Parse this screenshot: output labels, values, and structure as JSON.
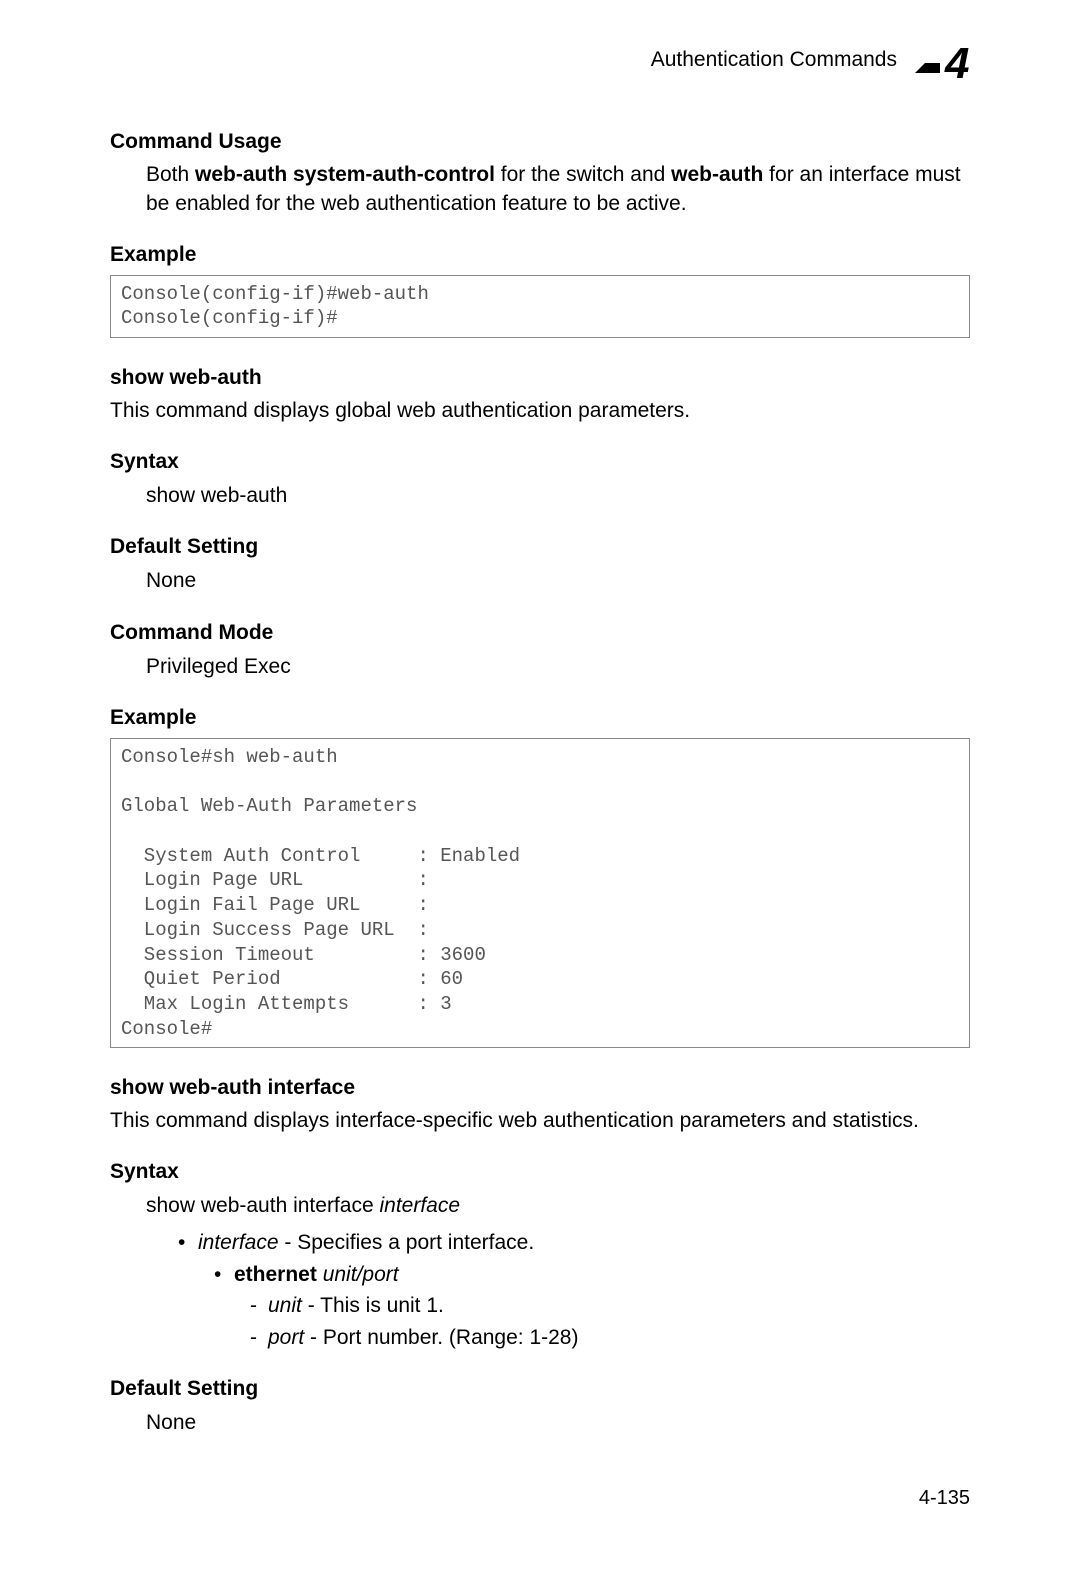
{
  "header": {
    "title": "Authentication Commands",
    "chapter_number": "4"
  },
  "sections": {
    "command_usage": {
      "heading": "Command Usage",
      "text_pre": "Both ",
      "bold1": "web-auth system-auth-control",
      "text_mid": " for the switch and ",
      "bold2": "web-auth",
      "text_post": " for an interface must be enabled for the web authentication feature to be active."
    },
    "example1": {
      "heading": "Example",
      "code": "Console(config-if)#web-auth\nConsole(config-if)#"
    },
    "show_web_auth": {
      "heading": "show web-auth",
      "description": "This command displays global web authentication parameters.",
      "syntax_heading": "Syntax",
      "syntax_text": "show web-auth",
      "default_heading": "Default Setting",
      "default_text": "None",
      "mode_heading": "Command Mode",
      "mode_text": "Privileged Exec"
    },
    "example2": {
      "heading": "Example",
      "code": "Console#sh web-auth\n\nGlobal Web-Auth Parameters\n\n  System Auth Control     : Enabled\n  Login Page URL          :\n  Login Fail Page URL     :\n  Login Success Page URL  :\n  Session Timeout         : 3600\n  Quiet Period            : 60\n  Max Login Attempts      : 3\nConsole#"
    },
    "show_web_auth_interface": {
      "heading": "show web-auth interface",
      "description": "This command displays interface-specific web authentication parameters and statistics.",
      "syntax_heading": "Syntax",
      "syntax_pre": "show web-auth interface ",
      "syntax_italic": "interface",
      "bullet1_italic": "interface",
      "bullet1_text": " - Specifies a port interface.",
      "bullet2_bold": "ethernet",
      "bullet2_italic": " unit",
      "bullet2_slash": "/",
      "bullet2_italic2": "port",
      "bullet3a_italic": "unit",
      "bullet3a_text": " - This is unit 1.",
      "bullet3b_italic": "port",
      "bullet3b_text": " - Port number. (Range: 1-28)",
      "default_heading": "Default Setting",
      "default_text": "None"
    }
  },
  "chart_data": {
    "type": "table",
    "title": "Global Web-Auth Parameters",
    "rows": [
      {
        "parameter": "System Auth Control",
        "value": "Enabled"
      },
      {
        "parameter": "Login Page URL",
        "value": ""
      },
      {
        "parameter": "Login Fail Page URL",
        "value": ""
      },
      {
        "parameter": "Login Success Page URL",
        "value": ""
      },
      {
        "parameter": "Session Timeout",
        "value": "3600"
      },
      {
        "parameter": "Quiet Period",
        "value": "60"
      },
      {
        "parameter": "Max Login Attempts",
        "value": "3"
      }
    ]
  },
  "page_number": "4-135"
}
